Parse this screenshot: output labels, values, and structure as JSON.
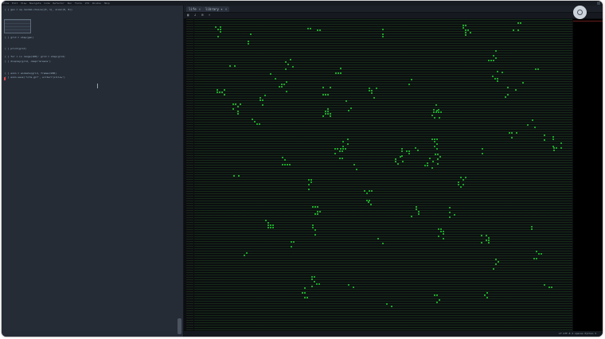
{
  "menubar": {
    "items": [
      "File",
      "Edit",
      "View",
      "Navigate",
      "Code",
      "Refactor",
      "Run",
      "Tools",
      "VCS",
      "Window",
      "Help"
    ]
  },
  "editor": {
    "tabs": [
      {
        "label": "life",
        "close": "×"
      },
      {
        "label": "library ▾",
        "close": "×"
      }
    ]
  },
  "console": {
    "lines": [
      "[ ] gen = np.random.choice([0, 1], size=(8, 8))",
      "",
      "[ ] grid = step(gen)",
      "[ ] print(grid)",
      "[ ] for i in range(100): grid = step(grid)",
      "[ ] display(grid, cmap='Greens')",
      "[ ] anim = animate(grid, frames=200)",
      "[ ] anim.save('life.gif', writer='pillow')"
    ]
  },
  "status": {
    "text": "LF  UTF-8  4 spaces  Python 3"
  },
  "colors": {
    "cell": "#1ea52b",
    "background": "#0b0d10",
    "panel": "#262c36"
  }
}
